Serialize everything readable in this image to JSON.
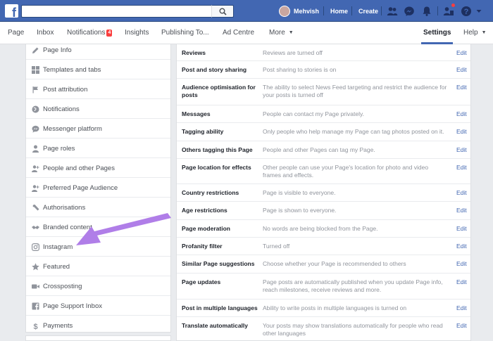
{
  "topbar": {
    "username": "Mehvish",
    "links": [
      "Home",
      "Create"
    ]
  },
  "nav": {
    "items": [
      "Page",
      "Inbox",
      "Notifications",
      "Insights",
      "Publishing To...",
      "Ad Centre",
      "More"
    ],
    "notifications_count": "4",
    "settings": "Settings",
    "help": "Help"
  },
  "sidebar": {
    "items": [
      {
        "label": "Page Info",
        "icon": "pencil-icon"
      },
      {
        "label": "Templates and tabs",
        "icon": "grid-icon"
      },
      {
        "label": "Post attribution",
        "icon": "flag-icon"
      },
      {
        "label": "Notifications",
        "icon": "globe-icon"
      },
      {
        "label": "Messenger platform",
        "icon": "messenger-icon"
      },
      {
        "label": "Page roles",
        "icon": "person-icon"
      },
      {
        "label": "People and other Pages",
        "icon": "people-icon"
      },
      {
        "label": "Preferred Page Audience",
        "icon": "people-icon"
      },
      {
        "label": "Authorisations",
        "icon": "wrench-icon"
      },
      {
        "label": "Branded content",
        "icon": "handshake-icon"
      },
      {
        "label": "Instagram",
        "icon": "instagram-icon"
      },
      {
        "label": "Featured",
        "icon": "star-icon"
      },
      {
        "label": "Crossposting",
        "icon": "video-icon"
      },
      {
        "label": "Page Support Inbox",
        "icon": "facebook-icon"
      },
      {
        "label": "Payments",
        "icon": "dollar-icon"
      }
    ]
  },
  "settings": {
    "edit_label": "Edit",
    "rows": [
      {
        "name": "Reviews",
        "value": "Reviews are turned off"
      },
      {
        "name": "Post and story sharing",
        "value": "Post sharing to stories is on"
      },
      {
        "name": "Audience optimisation for posts",
        "value": "The ability to select News Feed targeting and restrict the audience for your posts is turned off"
      },
      {
        "name": "Messages",
        "value": "People can contact my Page privately."
      },
      {
        "name": "Tagging ability",
        "value": "Only people who help manage my Page can tag photos posted on it."
      },
      {
        "name": "Others tagging this Page",
        "value": "People and other Pages can tag my Page."
      },
      {
        "name": "Page location for effects",
        "value": "Other people can use your Page's location for photo and video frames and effects."
      },
      {
        "name": "Country restrictions",
        "value": "Page is visible to everyone."
      },
      {
        "name": "Age restrictions",
        "value": "Page is shown to everyone."
      },
      {
        "name": "Page moderation",
        "value": "No words are being blocked from the Page."
      },
      {
        "name": "Profanity filter",
        "value": "Turned off"
      },
      {
        "name": "Similar Page suggestions",
        "value": "Choose whether your Page is recommended to others"
      },
      {
        "name": "Page updates",
        "value": "Page posts are automatically published when you update Page info, reach milestones, receive reviews and more."
      },
      {
        "name": "Post in multiple languages",
        "value": "Ability to write posts in multiple languages is turned on"
      },
      {
        "name": "Translate automatically",
        "value": "Your posts may show translations automatically for people who read other languages"
      }
    ]
  },
  "colors": {
    "brand": "#4267b2",
    "arrow": "#b07ee8",
    "badge": "#fa3e3e"
  }
}
